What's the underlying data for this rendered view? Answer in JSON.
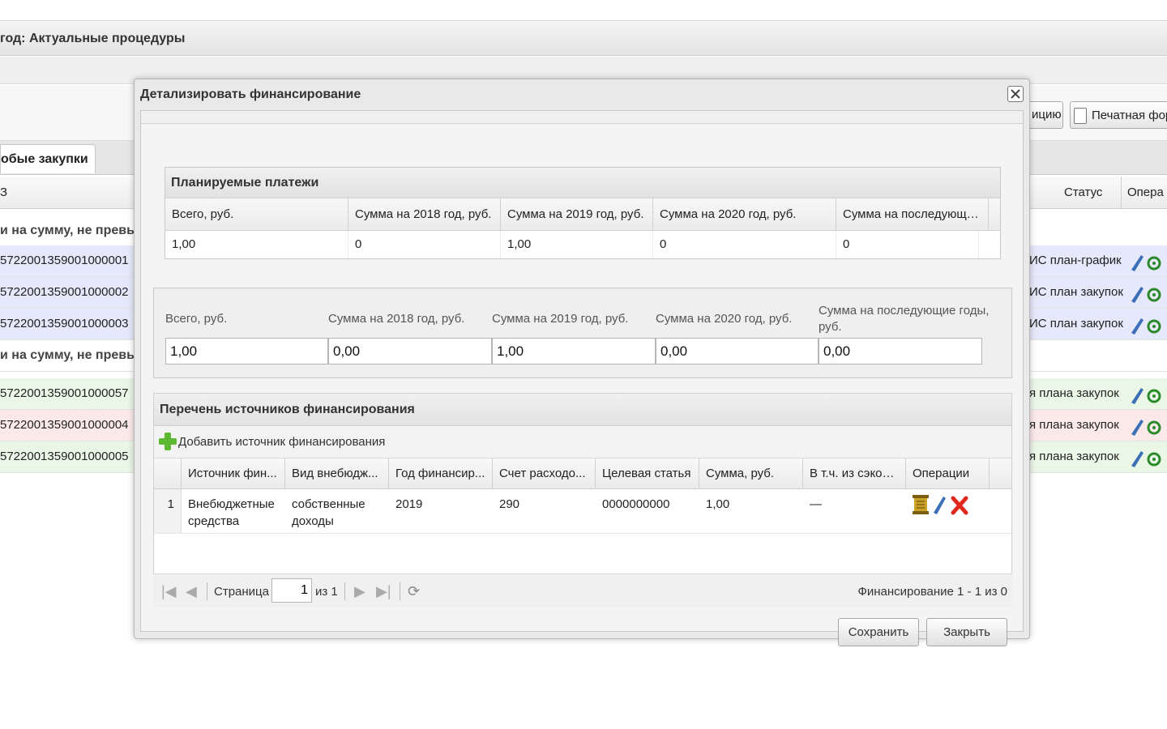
{
  "background": {
    "title": "год: Актуальные процедуры",
    "tab_label": "обые закупки",
    "col_left": "З",
    "col_status": "Статус",
    "col_ops": "Опера",
    "btn_partial": "ицию",
    "btn_print": "Печатная фор",
    "group1": "и на сумму, не превы",
    "group2": "и на сумму, не превы",
    "rows": [
      {
        "num": "5722001359001000001",
        "status": "ИС план-график"
      },
      {
        "num": "5722001359001000002",
        "status": "ИС план закупок"
      },
      {
        "num": "5722001359001000003",
        "status": "ИС план закупок"
      },
      {
        "num": "5722001359001000057",
        "status": "я плана закупок"
      },
      {
        "num": "5722001359001000004",
        "status": "я плана закупок"
      },
      {
        "num": "5722001359001000005",
        "status": "я плана закупок"
      }
    ]
  },
  "modal": {
    "title": "Детализировать финансирование",
    "planned": {
      "title": "Планируемые платежи",
      "columns": [
        "Всего, руб.",
        "Сумма на 2018 год, руб.",
        "Сумма на 2019 год, руб.",
        "Сумма на 2020 год, руб.",
        "Сумма на последующи..."
      ],
      "row": [
        "1,00",
        "0",
        "1,00",
        "0",
        "0"
      ]
    },
    "fields": {
      "labels": [
        "Всего, руб.",
        "Сумма на 2018 год, руб.",
        "Сумма на 2019 год, руб.",
        "Сумма на 2020 год, руб.",
        "Сумма на последующие годы, руб."
      ],
      "values": [
        "1,00",
        "0,00",
        "1,00",
        "0,00",
        "0,00"
      ]
    },
    "sources": {
      "title": "Перечень источников финансирования",
      "add_label": "Добавить источник финансирования",
      "columns": [
        "Источник фин...",
        "Вид внебюдж...",
        "Год финансир...",
        "Счет расходо...",
        "Целевая статья",
        "Сумма, руб.",
        "В т.ч. из сэкон...",
        "Операции"
      ],
      "rows": [
        {
          "n": "1",
          "source": "Внебюджетные средства",
          "kind": "собственные доходы",
          "year": "2019",
          "account": "290",
          "target": "0000000000",
          "sum": "1,00",
          "savings": "—"
        }
      ]
    },
    "pager": {
      "page_label": "Страница",
      "page_value": "1",
      "of_label": "из 1",
      "summary": "Финансирование 1 - 1 из 0"
    },
    "buttons": {
      "save": "Сохранить",
      "close": "Закрыть"
    }
  },
  "colors": {
    "row_blue": "#e6e8fb",
    "row_green": "#eaf6e6",
    "row_pink": "#fbe9ea",
    "add_icon": "#5cb82e",
    "delete_icon": "#e0291c"
  }
}
